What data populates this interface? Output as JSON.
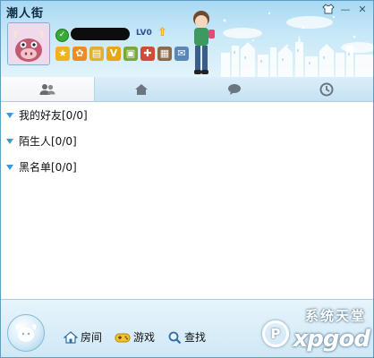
{
  "window": {
    "title": "潮人街"
  },
  "profile": {
    "level_text": "LV0",
    "quick_icons": [
      {
        "name": "star-icon",
        "color": "#f2b21c",
        "glyph": "★"
      },
      {
        "name": "flower-icon",
        "color": "#f08a24",
        "glyph": "✿"
      },
      {
        "name": "shop-icon",
        "color": "#e0b030",
        "glyph": "▤"
      },
      {
        "name": "vip-icon",
        "color": "#e8a615",
        "glyph": "V"
      },
      {
        "name": "box-icon",
        "color": "#7aa83a",
        "glyph": "▣"
      },
      {
        "name": "gift-icon",
        "color": "#d24a3a",
        "glyph": "✚"
      },
      {
        "name": "calendar-icon",
        "color": "#8a6a4a",
        "glyph": "▦"
      },
      {
        "name": "mail-icon",
        "color": "#5a87b8",
        "glyph": "✉"
      }
    ]
  },
  "tabs": [
    {
      "name": "tab-friends",
      "icon": "people-icon"
    },
    {
      "name": "tab-home",
      "icon": "house-icon"
    },
    {
      "name": "tab-chat",
      "icon": "chat-bubble-icon"
    },
    {
      "name": "tab-history",
      "icon": "clock-icon"
    }
  ],
  "groups": [
    {
      "label": "我的好友[0/0]"
    },
    {
      "label": "陌生人[0/0]"
    },
    {
      "label": "黑名单[0/0]"
    }
  ],
  "bottom": {
    "room_label": "房间",
    "game_label": "游戏",
    "search_label": "查找"
  },
  "watermark": {
    "text": "系统天堂",
    "domain": "xpgod"
  },
  "colors": {
    "accent": "#3a9ad6",
    "header_top": "#a9d9f2",
    "status_online": "#39a937"
  }
}
